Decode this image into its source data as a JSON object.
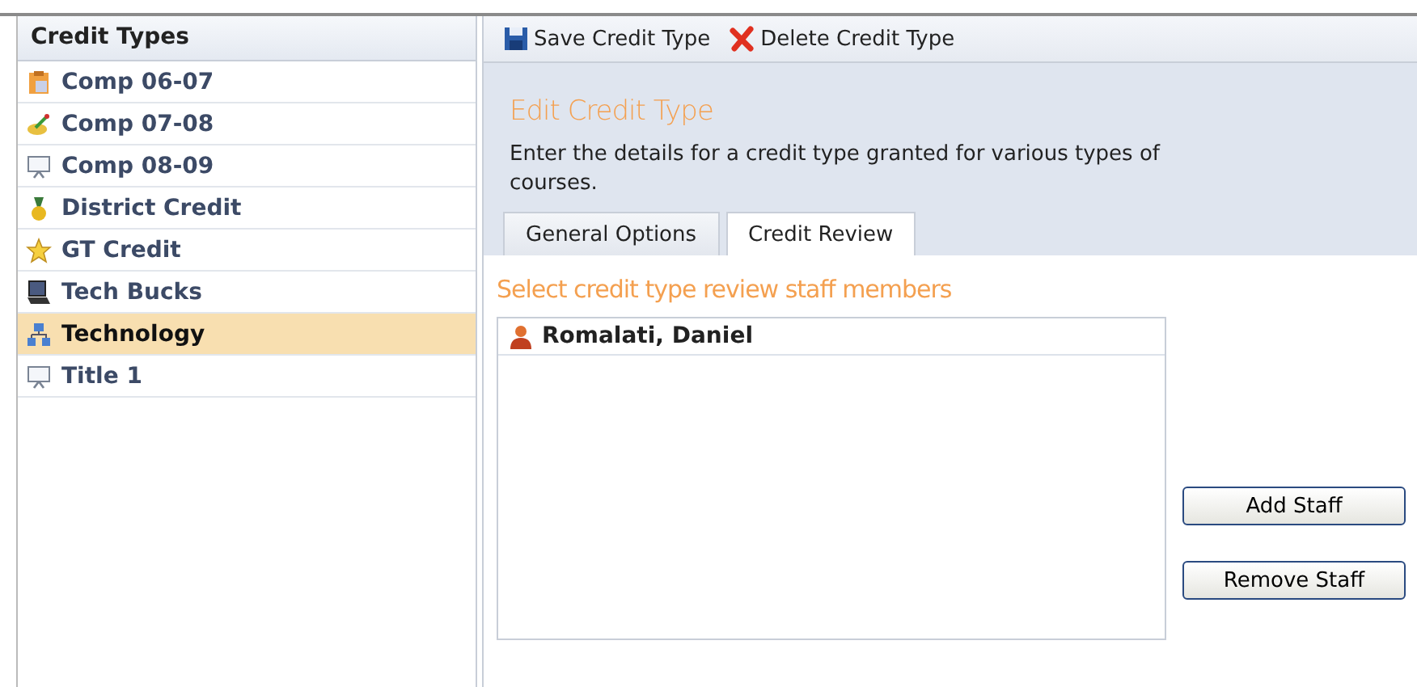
{
  "sidebar": {
    "title": "Credit Types",
    "items": [
      {
        "label": "Comp 06-07",
        "selected": false
      },
      {
        "label": "Comp 07-08",
        "selected": false
      },
      {
        "label": "Comp 08-09",
        "selected": false
      },
      {
        "label": "District Credit",
        "selected": false
      },
      {
        "label": "GT Credit",
        "selected": false
      },
      {
        "label": "Tech Bucks",
        "selected": false
      },
      {
        "label": "Technology",
        "selected": true
      },
      {
        "label": "Title 1",
        "selected": false
      }
    ]
  },
  "toolbar": {
    "buttons": [
      {
        "kind": "save",
        "label": "Save Credit Type"
      },
      {
        "kind": "delete",
        "label": "Delete Credit Type"
      }
    ]
  },
  "editor": {
    "title": "Edit Credit Type",
    "description": "Enter the details for a credit type granted for various types of courses.",
    "tabs": [
      {
        "label": "General Options",
        "selected": false
      },
      {
        "label": "Credit Review",
        "selected": true
      }
    ],
    "section_title": "Select credit type review staff members",
    "staff": [
      {
        "name": "Romalati, Daniel"
      }
    ],
    "buttons": [
      "Add Staff",
      "Remove Staff"
    ]
  }
}
